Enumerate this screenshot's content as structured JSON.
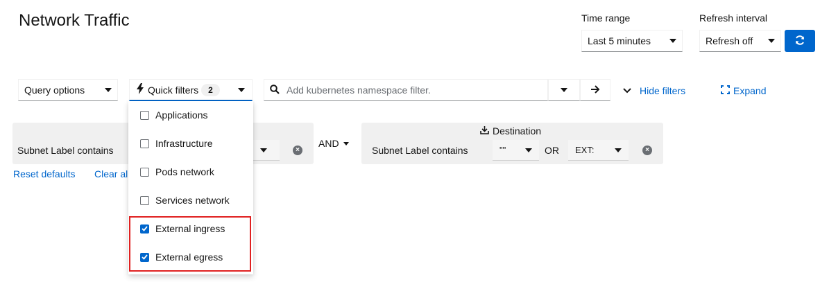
{
  "page": {
    "title": "Network Traffic"
  },
  "time_range": {
    "label": "Time range",
    "value": "Last 5 minutes"
  },
  "refresh": {
    "label": "Refresh interval",
    "value": "Refresh off"
  },
  "toolbar": {
    "query_options": "Query options",
    "quick_filters": "Quick filters",
    "quick_filters_count": "2",
    "search_placeholder": "Add kubernetes namespace filter.",
    "hide_filters": "Hide filters",
    "expand": "Expand"
  },
  "filters": {
    "source": {
      "chip_label": "Subnet Label contains"
    },
    "operator": "AND",
    "destination": {
      "title": "Destination",
      "chip_label": "Subnet Label contains",
      "value1": "\"\"",
      "or_label": "OR",
      "value2": "EXT:"
    },
    "reset_defaults": "Reset defaults",
    "clear_all": "Clear all"
  },
  "quick_filter_menu": {
    "items": [
      {
        "label": "Applications",
        "checked": false
      },
      {
        "label": "Infrastructure",
        "checked": false
      },
      {
        "label": "Pods network",
        "checked": false
      },
      {
        "label": "Services network",
        "checked": false
      },
      {
        "label": "External ingress",
        "checked": true
      },
      {
        "label": "External egress",
        "checked": true
      }
    ]
  },
  "colors": {
    "accent": "#0066cc",
    "highlight": "#e02020"
  },
  "icons": [
    "sync-icon",
    "bolt-icon",
    "search-icon",
    "arrow-right-icon",
    "chevron-down-icon",
    "expand-icon",
    "download-icon",
    "close-circle-icon",
    "check-icon"
  ]
}
